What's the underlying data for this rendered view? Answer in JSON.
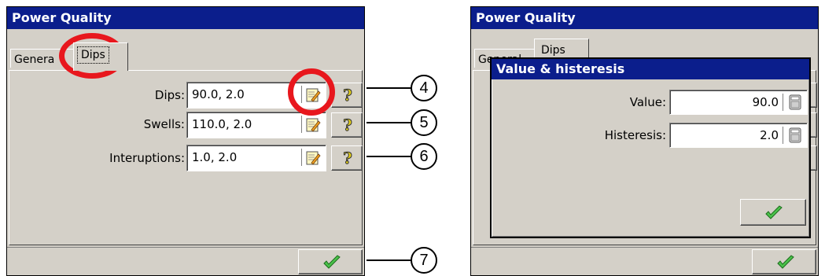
{
  "left_window": {
    "title": "Power Quality",
    "tabs": [
      {
        "label": "Genera"
      },
      {
        "label": "Dips"
      }
    ],
    "rows": [
      {
        "label": "Dips:",
        "value": "90.0, 2.0"
      },
      {
        "label": "Swells:",
        "value": "110.0, 2.0"
      },
      {
        "label": "Interuptions:",
        "value": "1.0, 2.0"
      }
    ],
    "icons": {
      "edit": "notepad-icon",
      "help": "question-mark-icon",
      "ok": "checkmark-icon"
    }
  },
  "callouts": [
    "4",
    "5",
    "6",
    "7"
  ],
  "right_window": {
    "title": "Power Quality",
    "tabs": [
      {
        "label": "General"
      },
      {
        "label": "Dips"
      }
    ],
    "dialog": {
      "title": "Value & histeresis",
      "fields": [
        {
          "label": "Value:",
          "value": "90.0"
        },
        {
          "label": "Histeresis:",
          "value": "2.0"
        }
      ]
    }
  },
  "colors": {
    "titlebar": "#0b1e8c",
    "window_bg": "#d4d0c8",
    "highlight_ring": "#e8171d",
    "check_green": "#1c9a1c"
  }
}
